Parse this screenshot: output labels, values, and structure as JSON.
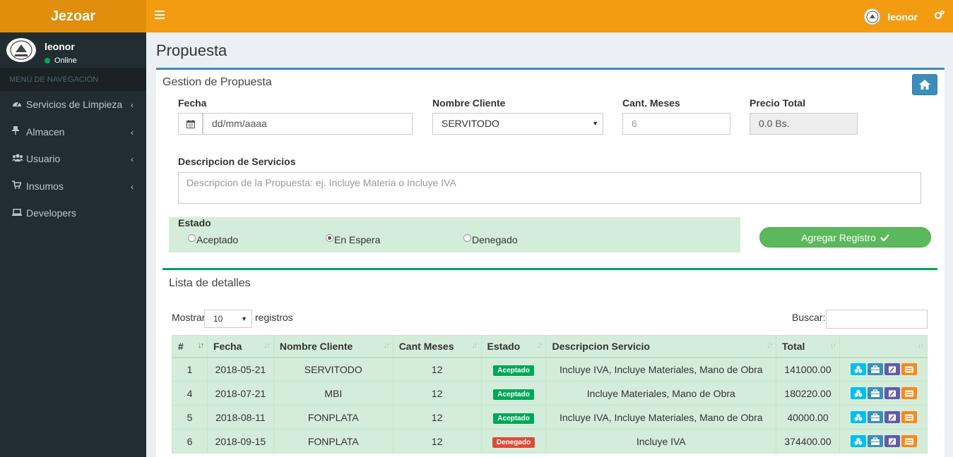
{
  "app": {
    "brand": "Jezoar",
    "user": "leonor",
    "status": "Online"
  },
  "sidebar": {
    "header": "MENÚ DE NAVEGACIÓN",
    "items": [
      {
        "label": "Servicios de Limpieza",
        "icon": "dashboard-icon"
      },
      {
        "label": "Almacen",
        "icon": "pin-icon"
      },
      {
        "label": "Usuario",
        "icon": "users-icon"
      },
      {
        "label": "Insumos",
        "icon": "cart-icon"
      },
      {
        "label": "Developers",
        "icon": "laptop-icon"
      }
    ]
  },
  "page": {
    "title": "Propuesta"
  },
  "form": {
    "title": "Gestion de Propuesta",
    "fecha_label": "Fecha",
    "fecha_placeholder": "dd/mm/aaaa",
    "cliente_label": "Nombre Cliente",
    "cliente_value": "SERVITODO",
    "meses_label": "Cant. Meses",
    "meses_placeholder": "6",
    "precio_label": "Precio Total",
    "precio_value": "0.0 Bs.",
    "desc_label": "Descripcion de Servicios",
    "desc_placeholder": "Descripcion de la Propuesta: ej. Incluye Materia o Incluye IVA",
    "estado_label": "Estado",
    "estado_options": [
      "Aceptado",
      "En Espera",
      "Denegado"
    ],
    "estado_selected": "En Espera",
    "submit_label": "Agregar Registro"
  },
  "list": {
    "title": "Lista de detalles",
    "show_label": "Mostrar",
    "show_value": "10",
    "records_label": "registros",
    "search_label": "Buscar:",
    "columns": [
      "#",
      "Fecha",
      "Nombre Cliente",
      "Cant Meses",
      "Estado",
      "Descripcion Servicio",
      "Total",
      ""
    ],
    "rows": [
      {
        "id": "1",
        "fecha": "2018-05-21",
        "cliente": "SERVITODO",
        "meses": "12",
        "estado": "Aceptado",
        "descripcion": "Incluye IVA, Incluye Materiales, Mano de Obra",
        "total": "141000.00"
      },
      {
        "id": "4",
        "fecha": "2018-07-21",
        "cliente": "MBI",
        "meses": "12",
        "estado": "Aceptado",
        "descripcion": "Incluye Materiales, Mano de Obra",
        "total": "180220.00"
      },
      {
        "id": "5",
        "fecha": "2018-08-11",
        "cliente": "FONPLATA",
        "meses": "12",
        "estado": "Aceptado",
        "descripcion": "Incluye IVA, Incluye Materiales, Mano de Obra",
        "total": "40000.00"
      },
      {
        "id": "6",
        "fecha": "2018-09-15",
        "cliente": "FONPLATA",
        "meses": "12",
        "estado": "Denegado",
        "descripcion": "Incluye IVA",
        "total": "374400.00"
      }
    ]
  },
  "colors": {
    "header": "#f39c12",
    "logo": "#e08e0b",
    "sidebar": "#222d32",
    "aceptado": "#00a65a",
    "denegado": "#dd4b39",
    "action_view": "#00c0ef",
    "action_briefcase": "#3c8dbc",
    "action_edit": "#605ca8",
    "action_list": "#ff851b"
  }
}
